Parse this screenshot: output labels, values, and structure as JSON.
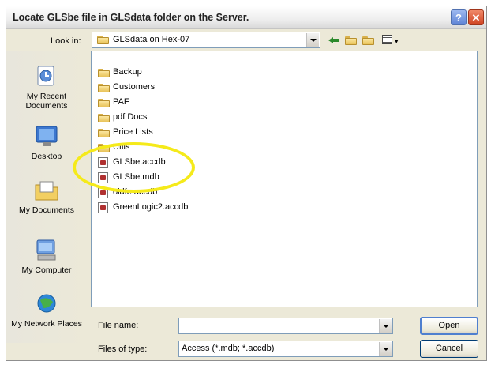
{
  "window": {
    "title": "Locate GLSbe file in GLSdata folder on the Server.",
    "help_glyph": "?",
    "close_glyph": "✕"
  },
  "toolbar": {
    "lookin_label": "Look in:",
    "lookin_value": "GLSdata on Hex-07",
    "views_caret": "▾"
  },
  "places": [
    {
      "label": "My Recent Documents",
      "icon": "recent-documents-icon"
    },
    {
      "label": "Desktop",
      "icon": "desktop-icon"
    },
    {
      "label": "My Documents",
      "icon": "my-documents-icon"
    },
    {
      "label": "My Computer",
      "icon": "my-computer-icon"
    },
    {
      "label": "My Network Places",
      "icon": "network-places-icon"
    }
  ],
  "files": [
    {
      "name": "Backup",
      "type": "folder"
    },
    {
      "name": "Customers",
      "type": "folder"
    },
    {
      "name": "PAF",
      "type": "folder"
    },
    {
      "name": "pdf Docs",
      "type": "folder"
    },
    {
      "name": "Price Lists",
      "type": "folder"
    },
    {
      "name": "Utils",
      "type": "folder"
    },
    {
      "name": "GLSbe.accdb",
      "type": "access"
    },
    {
      "name": "GLSbe.mdb",
      "type": "access"
    },
    {
      "name": "oldfe.accdb",
      "type": "access"
    },
    {
      "name": "GreenLogic2.accdb",
      "type": "access"
    }
  ],
  "footer": {
    "filename_label": "File name:",
    "filename_value": "",
    "filetype_label": "Files of type:",
    "filetype_value": "Access (*.mdb; *.accdb)",
    "open_label": "Open",
    "cancel_label": "Cancel"
  },
  "colors": {
    "highlight": "#f5ea1a",
    "dialog_bg": "#ece9d8"
  }
}
